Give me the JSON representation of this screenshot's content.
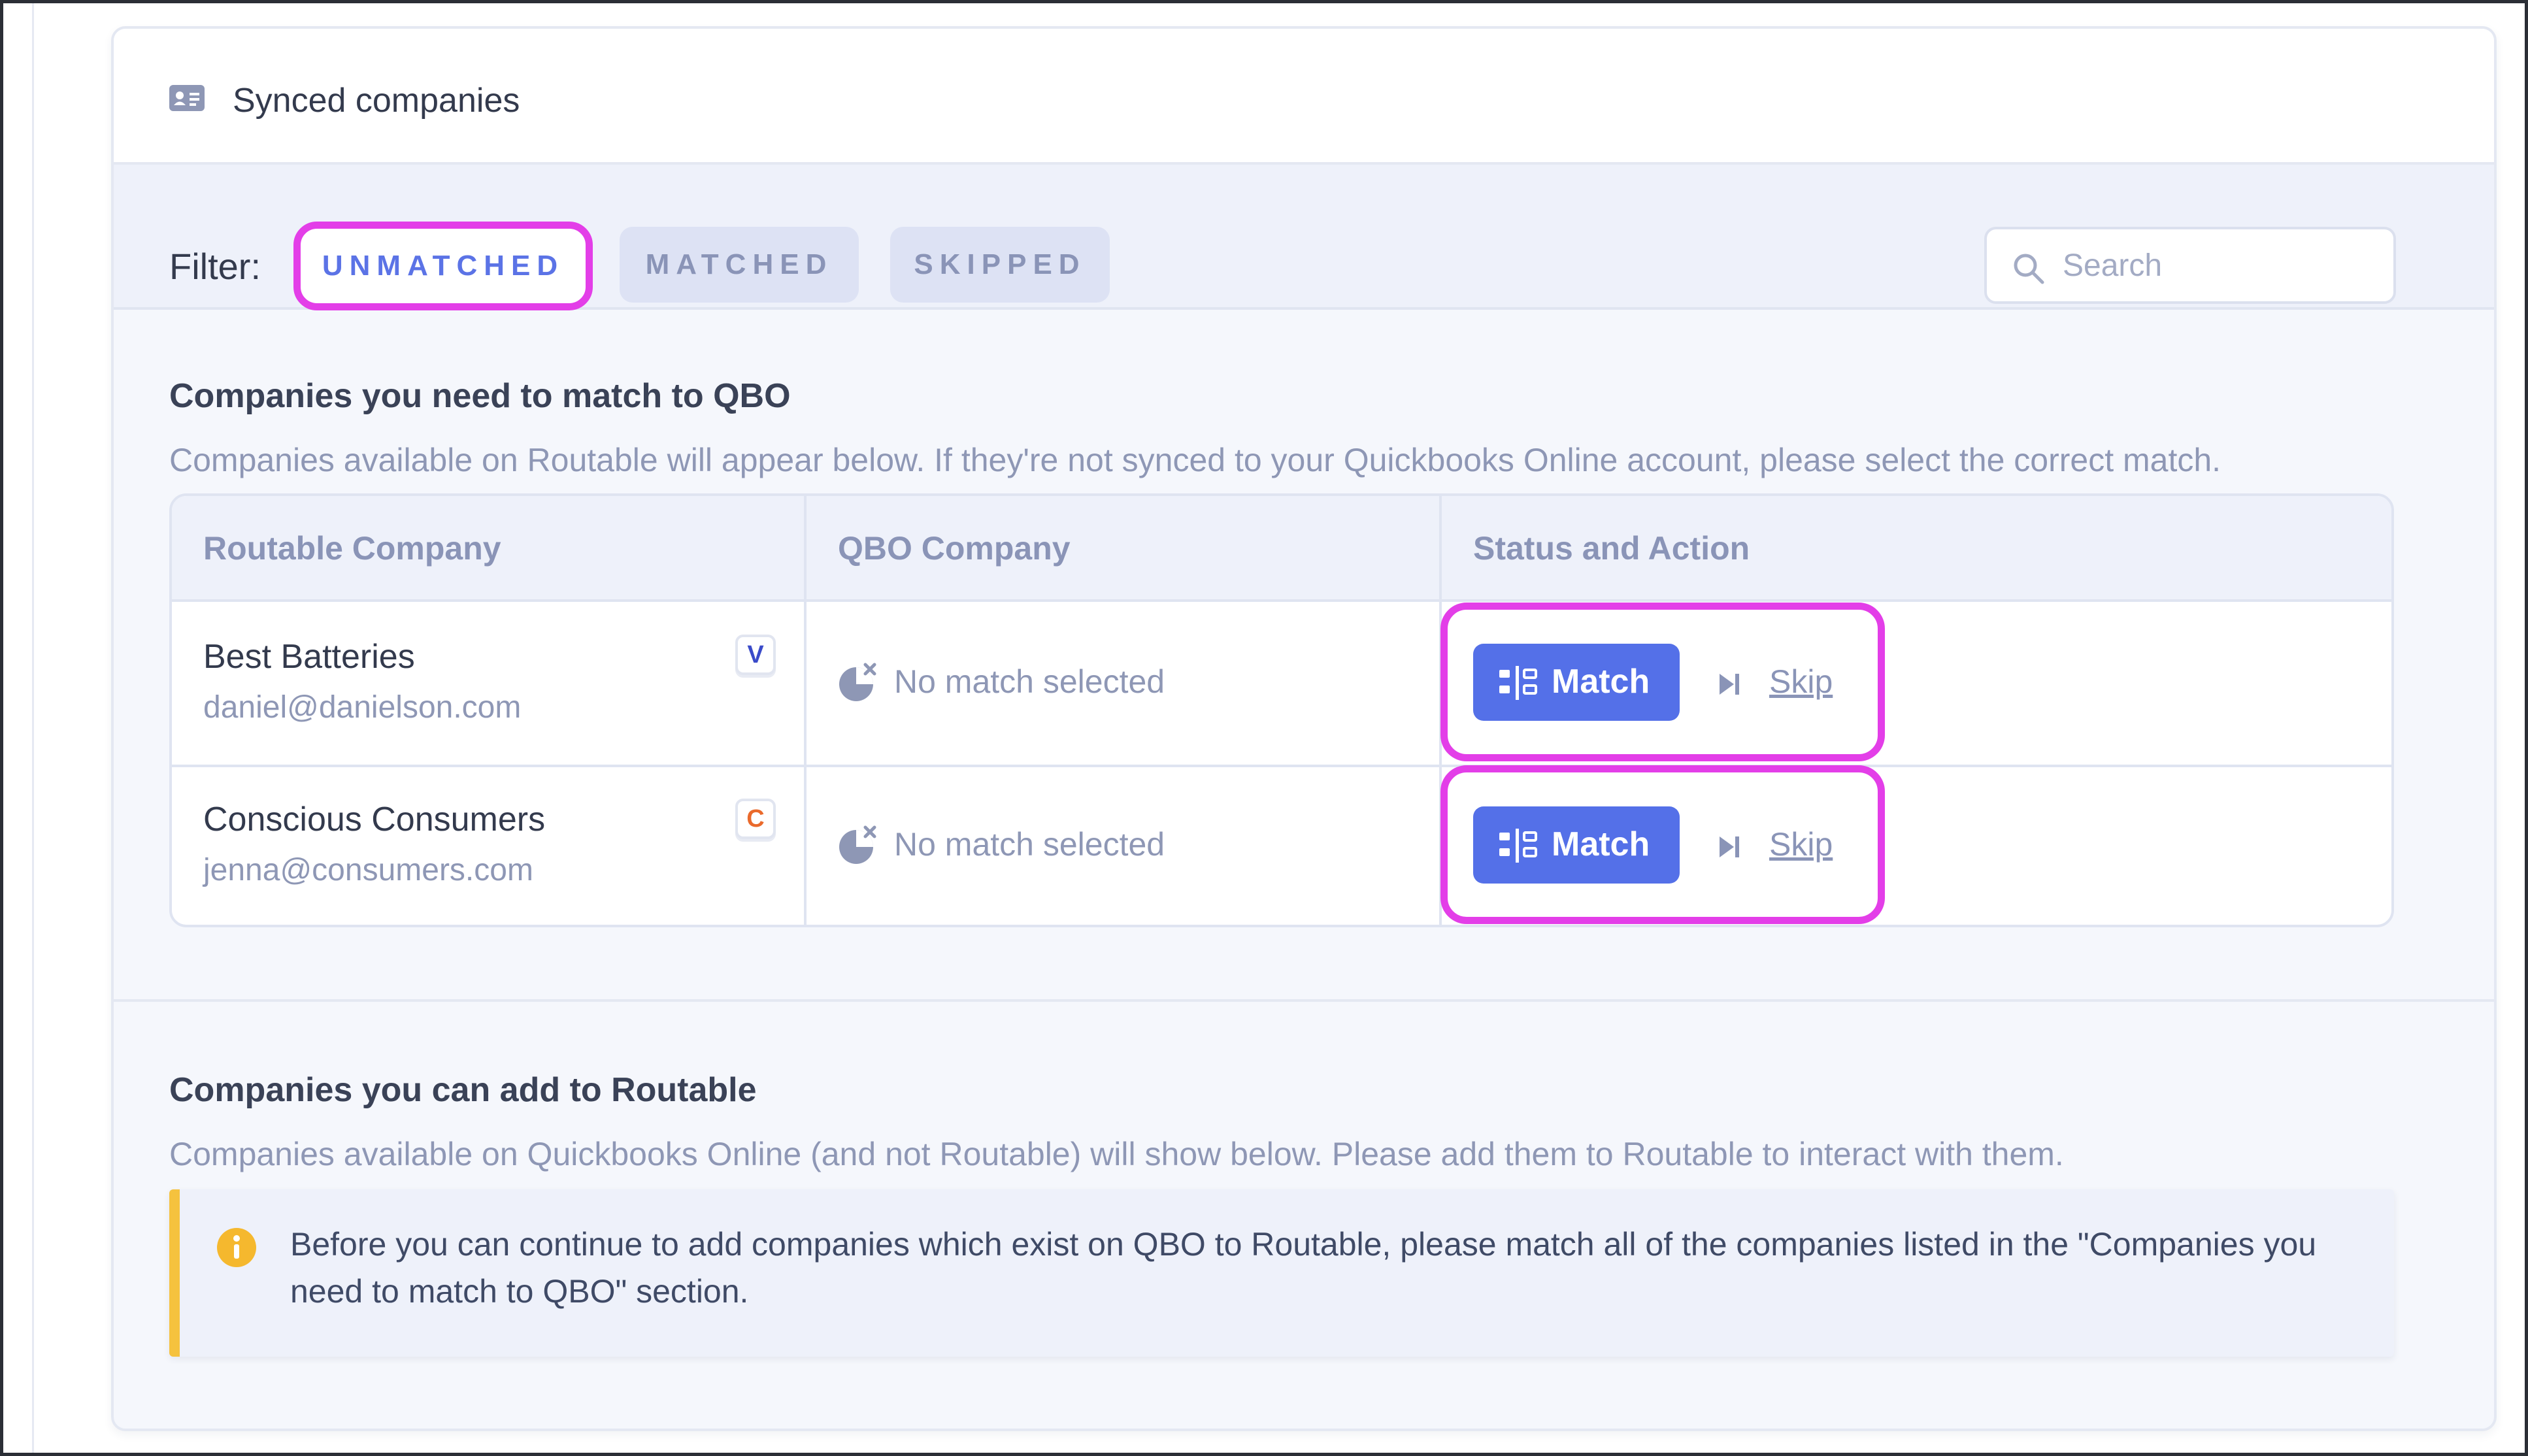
{
  "header": {
    "title": "Synced companies",
    "icon": "id-card-icon"
  },
  "filter": {
    "label": "Filter:",
    "chips": [
      {
        "label": "UNMATCHED",
        "active": true
      },
      {
        "label": "MATCHED",
        "active": false
      },
      {
        "label": "SKIPPED",
        "active": false
      }
    ],
    "search_placeholder": "Search"
  },
  "match_section": {
    "title": "Companies you need to match to QBO",
    "description": "Companies available on Routable will appear below. If they're not synced to your Quickbooks Online account, please select the correct match.",
    "columns": [
      "Routable Company",
      "QBO Company",
      "Status and Action"
    ],
    "rows": [
      {
        "name": "Best Batteries",
        "email": "daniel@danielson.com",
        "badge": "V",
        "qbo_status": "No match selected",
        "match_label": "Match",
        "skip_label": "Skip"
      },
      {
        "name": "Conscious Consumers",
        "email": "jenna@consumers.com",
        "badge": "C",
        "qbo_status": "No match selected",
        "match_label": "Match",
        "skip_label": "Skip"
      }
    ]
  },
  "add_section": {
    "title": "Companies you can add to Routable",
    "description": "Companies available on Quickbooks Online (and not Routable) will show below. Please add them to Routable to interact with them.",
    "alert": "Before you can continue to add companies which exist on QBO to Routable, please match all of the companies listed in the \"Companies you need to match to QBO\" section."
  },
  "colors": {
    "accent": "#5470e8",
    "highlight": "#e33ee8",
    "warning": "#f5c23e",
    "badge_v": "#3a4bc9",
    "badge_c": "#ea6a2c"
  }
}
